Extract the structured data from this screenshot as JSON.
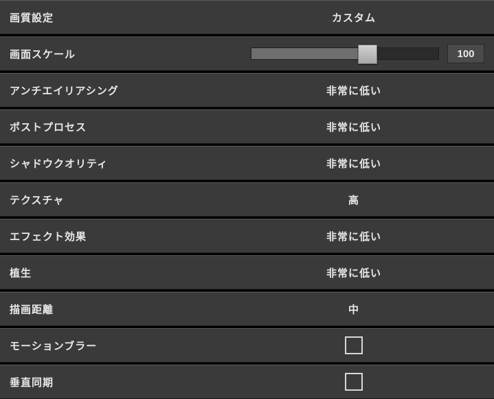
{
  "settings": {
    "quality_preset": {
      "label": "画質設定",
      "value": "カスタム"
    },
    "render_scale": {
      "label": "画面スケール",
      "value": 100,
      "percent": 62
    },
    "anti_aliasing": {
      "label": "アンチエイリアシング",
      "value": "非常に低い"
    },
    "post_process": {
      "label": "ポストプロセス",
      "value": "非常に低い"
    },
    "shadow_quality": {
      "label": "シャドウクオリティ",
      "value": "非常に低い"
    },
    "texture": {
      "label": "テクスチャ",
      "value": "高"
    },
    "effects": {
      "label": "エフェクト効果",
      "value": "非常に低い"
    },
    "foliage": {
      "label": "植生",
      "value": "非常に低い"
    },
    "view_distance": {
      "label": "描画距離",
      "value": "中"
    },
    "motion_blur": {
      "label": "モーションブラー",
      "checked": false
    },
    "vsync": {
      "label": "垂直同期",
      "checked": false
    }
  }
}
